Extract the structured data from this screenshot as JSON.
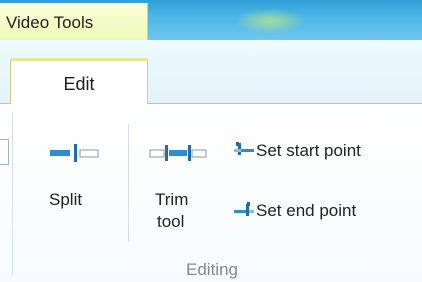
{
  "contextual_tab": {
    "label": "Video Tools"
  },
  "tabs": [
    {
      "label": "Edit",
      "selected": true
    }
  ],
  "groups": [
    {
      "label": "Editing",
      "buttons": {
        "split": {
          "label": "Split",
          "icon": "split-icon"
        },
        "trim": {
          "label_line1": "Trim",
          "label_line2": "tool",
          "icon": "trim-tool-icon"
        },
        "set_start": {
          "label": "Set start point",
          "icon": "set-start-point-icon"
        },
        "set_end": {
          "label": "Set end point",
          "icon": "set-end-point-icon"
        }
      }
    }
  ],
  "colors": {
    "accent": "#2f9fd6",
    "icon_blue": "#2a8ed3",
    "contextual": "#eef9b8"
  }
}
